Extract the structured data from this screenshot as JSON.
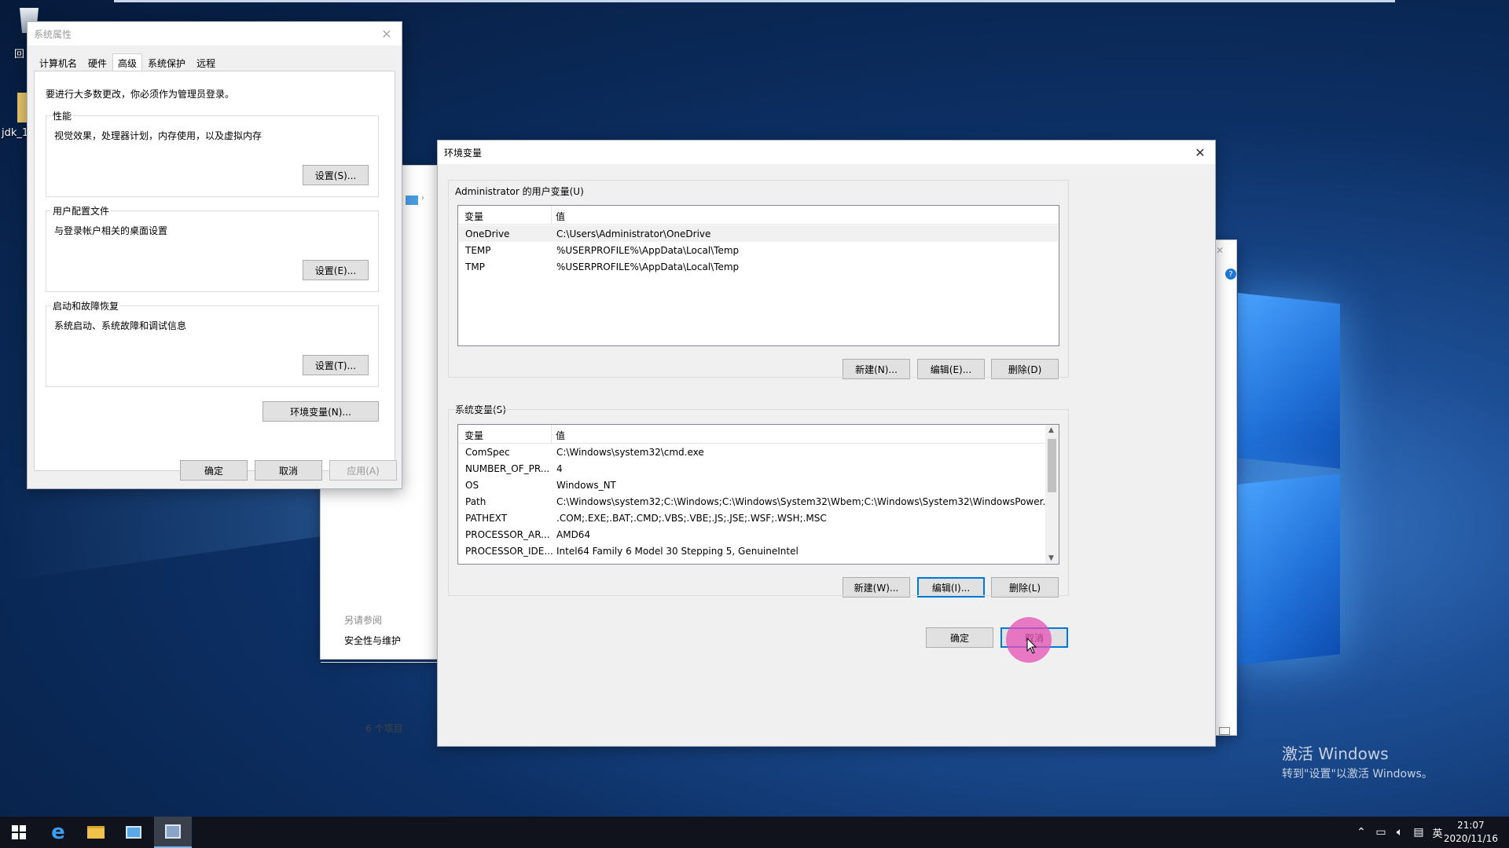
{
  "desktop": {
    "recycle_label": "回",
    "jdk_label": "jdk_1"
  },
  "system_properties": {
    "title": "系统属性",
    "tabs": [
      "计算机名",
      "硬件",
      "高级",
      "系统保护",
      "远程"
    ],
    "active_tab": "高级",
    "admin_note": "要进行大多数更改，你必须作为管理员登录。",
    "performance": {
      "label": "性能",
      "desc": "视觉效果，处理器计划，内存使用，以及虚拟内存",
      "button": "设置(S)..."
    },
    "user_profiles": {
      "label": "用户配置文件",
      "desc": "与登录帐户相关的桌面设置",
      "button": "设置(E)..."
    },
    "startup_recovery": {
      "label": "启动和故障恢复",
      "desc": "系统启动、系统故障和调试信息",
      "button": "设置(T)..."
    },
    "env_button": "环境变量(N)...",
    "ok": "确定",
    "cancel": "取消",
    "apply": "应用(A)"
  },
  "explorer_bg": {
    "see_also": "另请参阅",
    "security_link": "安全性与维护",
    "item_count": "6 个项目"
  },
  "env_vars": {
    "title": "环境变量",
    "user_section": {
      "label": "Administrator 的用户变量(U)",
      "headers": [
        "变量",
        "值"
      ],
      "rows": [
        {
          "name": "OneDrive",
          "value": "C:\\Users\\Administrator\\OneDrive"
        },
        {
          "name": "TEMP",
          "value": "%USERPROFILE%\\AppData\\Local\\Temp"
        },
        {
          "name": "TMP",
          "value": "%USERPROFILE%\\AppData\\Local\\Temp"
        }
      ],
      "new": "新建(N)...",
      "edit": "编辑(E)...",
      "delete": "删除(D)"
    },
    "system_section": {
      "label": "系统变量(S)",
      "headers": [
        "变量",
        "值"
      ],
      "rows": [
        {
          "name": "ComSpec",
          "value": "C:\\Windows\\system32\\cmd.exe"
        },
        {
          "name": "NUMBER_OF_PR...",
          "value": "4"
        },
        {
          "name": "OS",
          "value": "Windows_NT"
        },
        {
          "name": "Path",
          "value": "C:\\Windows\\system32;C:\\Windows;C:\\Windows\\System32\\Wbem;C:\\Windows\\System32\\WindowsPower..."
        },
        {
          "name": "PATHEXT",
          "value": ".COM;.EXE;.BAT;.CMD;.VBS;.VBE;.JS;.JSE;.WSF;.WSH;.MSC"
        },
        {
          "name": "PROCESSOR_AR...",
          "value": "AMD64"
        },
        {
          "name": "PROCESSOR_IDE...",
          "value": "Intel64 Family 6 Model 30 Stepping 5, GenuineIntel"
        }
      ],
      "new": "新建(W)...",
      "edit": "编辑(I)...",
      "delete": "删除(L)"
    },
    "ok": "确定",
    "cancel": "取消"
  },
  "watermark": {
    "line1": "激活 Windows",
    "line2": "转到\"设置\"以激活 Windows。"
  },
  "taskbar": {
    "ime": "英",
    "time": "21:07",
    "date": "2020/11/16"
  }
}
